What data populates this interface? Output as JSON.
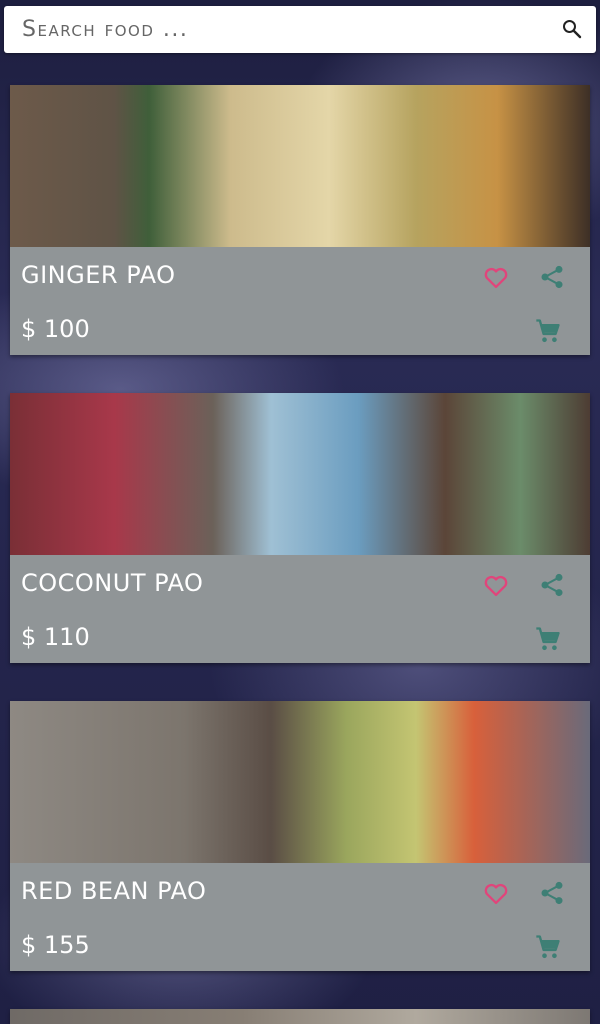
{
  "search": {
    "placeholder": "Search food ..."
  },
  "colors": {
    "card_body": "#909597",
    "favorite": "#e0457b",
    "action": "#3e7f75"
  },
  "items": [
    {
      "title": "GINGER PAO",
      "price": "$ 100"
    },
    {
      "title": "COCONUT PAO",
      "price": "$ 110"
    },
    {
      "title": "RED BEAN PAO",
      "price": "$ 155"
    }
  ]
}
